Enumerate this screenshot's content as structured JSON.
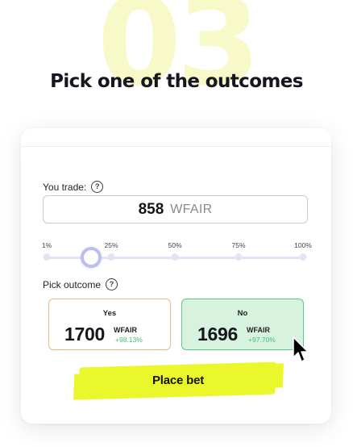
{
  "step": {
    "number": "03",
    "headline": "Pick one of the outcomes"
  },
  "trade": {
    "label": "You trade:",
    "amount": "858",
    "unit": "WFAIR"
  },
  "slider": {
    "ticks": [
      "1%",
      "25%",
      "50%",
      "75%",
      "100%"
    ],
    "value_percent": 18
  },
  "outcomes": {
    "label": "Pick outcome",
    "yes": {
      "label": "Yes",
      "amount": "1700",
      "unit": "WFAIR",
      "change": "+98.13%",
      "border_color": "#f5b97f"
    },
    "no": {
      "label": "No",
      "amount": "1696",
      "unit": "WFAIR",
      "change": "+97.70%",
      "border_color": "#59c98a",
      "selected": true
    }
  },
  "action": {
    "label": "Place bet",
    "highlight_color": "#eaf72a"
  },
  "icons": {
    "help": "question-circle-icon",
    "cursor": "mouse-pointer-icon"
  }
}
